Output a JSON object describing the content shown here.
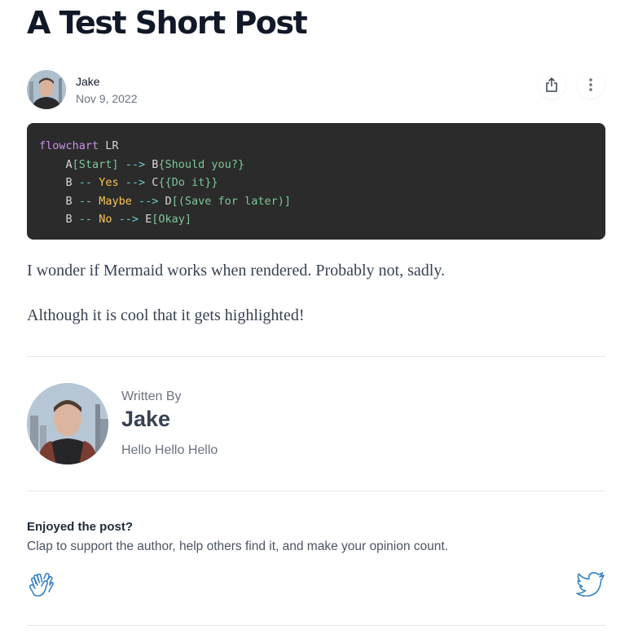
{
  "post": {
    "title": "A Test Short Post",
    "author": "Jake",
    "date": "Nov 9, 2022",
    "code": {
      "language_keyword": "flowchart",
      "direction": "LR",
      "lines": [
        {
          "a": "A",
          "b1": "[Start]",
          "arrow": "-->",
          "c": "B",
          "b2": "{Should you?}"
        },
        {
          "a": "B",
          "d1": "--",
          "label": "Yes",
          "arrow": "-->",
          "c": "C",
          "b2": "{{Do it}}"
        },
        {
          "a": "B",
          "d1": "--",
          "label": "Maybe",
          "arrow": "-->",
          "c": "D",
          "b2": "[(Save for later)]"
        },
        {
          "a": "B",
          "d1": "--",
          "label": "No",
          "arrow": "-->",
          "c": "E",
          "b2": "[Okay]"
        }
      ]
    },
    "paragraphs": [
      "I wonder if Mermaid works when rendered. Probably not, sadly.",
      "Although it is cool that it gets highlighted!"
    ]
  },
  "author_card": {
    "written_by_label": "Written By",
    "name": "Jake",
    "bio": "Hello Hello Hello"
  },
  "engagement": {
    "title": "Enjoyed the post?",
    "subtitle": "Clap to support the author, help others find it, and make your opinion count."
  },
  "icons": {
    "share": "share-icon",
    "more": "more-vertical-icon",
    "clap": "clap-icon",
    "twitter": "twitter-icon"
  },
  "colors": {
    "code_bg": "#2b2b2b",
    "accent_icon": "#3b82c4"
  }
}
